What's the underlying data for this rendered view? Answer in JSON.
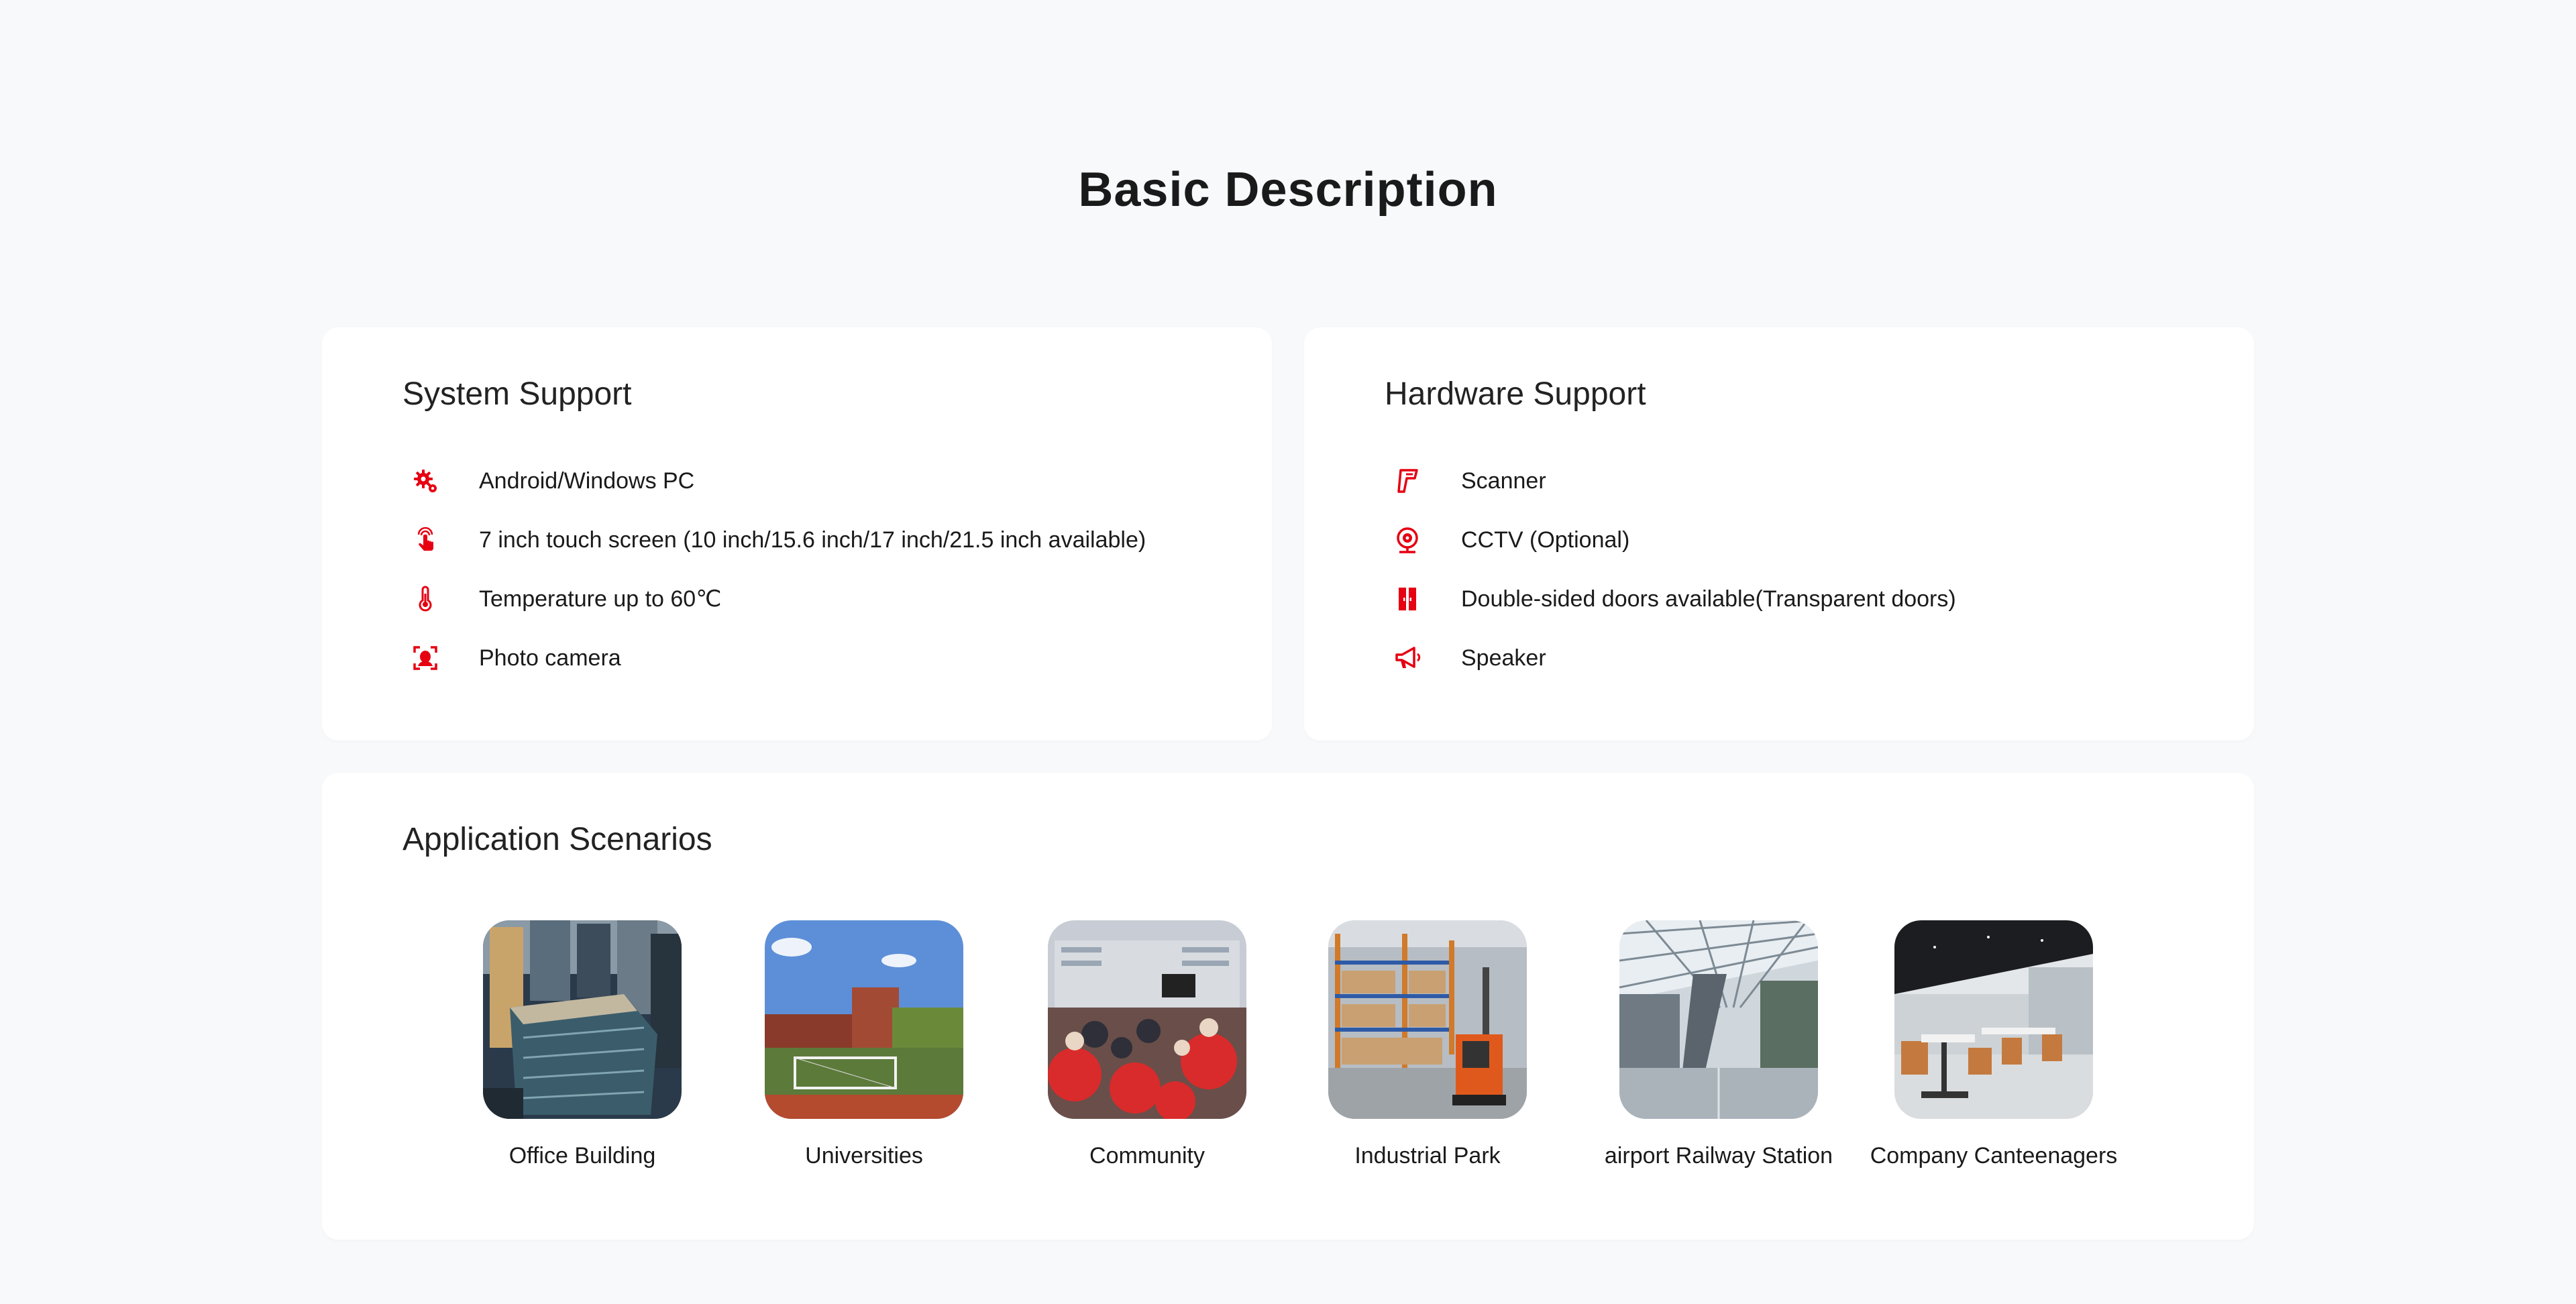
{
  "page": {
    "title": "Basic Description",
    "accent_color": "#e60012",
    "background_color": "#f8f9fa"
  },
  "system_support": {
    "title": "System Support",
    "items": [
      {
        "icon": "gear-settings-icon",
        "label": "Android/Windows PC"
      },
      {
        "icon": "touch-finger-icon",
        "label": "7 inch touch screen (10 inch/15.6 inch/17 inch/21.5 inch available)"
      },
      {
        "icon": "thermometer-icon",
        "label": "Temperature up to 60℃"
      },
      {
        "icon": "face-camera-icon",
        "label": "Photo camera"
      }
    ]
  },
  "hardware_support": {
    "title": "Hardware Support",
    "items": [
      {
        "icon": "scanner-icon",
        "label": "Scanner"
      },
      {
        "icon": "cctv-camera-icon",
        "label": "CCTV (Optional)"
      },
      {
        "icon": "double-door-icon",
        "label": "Double-sided doors available(Transparent doors)"
      },
      {
        "icon": "megaphone-speaker-icon",
        "label": "Speaker"
      }
    ]
  },
  "application_scenarios": {
    "title": "Application Scenarios",
    "items": [
      {
        "image": "office-building-photo",
        "label": "Office Building"
      },
      {
        "image": "university-campus-photo",
        "label": "Universities"
      },
      {
        "image": "community-crowd-photo",
        "label": "Community"
      },
      {
        "image": "industrial-warehouse-photo",
        "label": "Industrial Park"
      },
      {
        "image": "airport-terminal-photo",
        "label": "airport Railway Station"
      },
      {
        "image": "company-canteen-photo",
        "label": "Company Canteenagers"
      }
    ]
  }
}
